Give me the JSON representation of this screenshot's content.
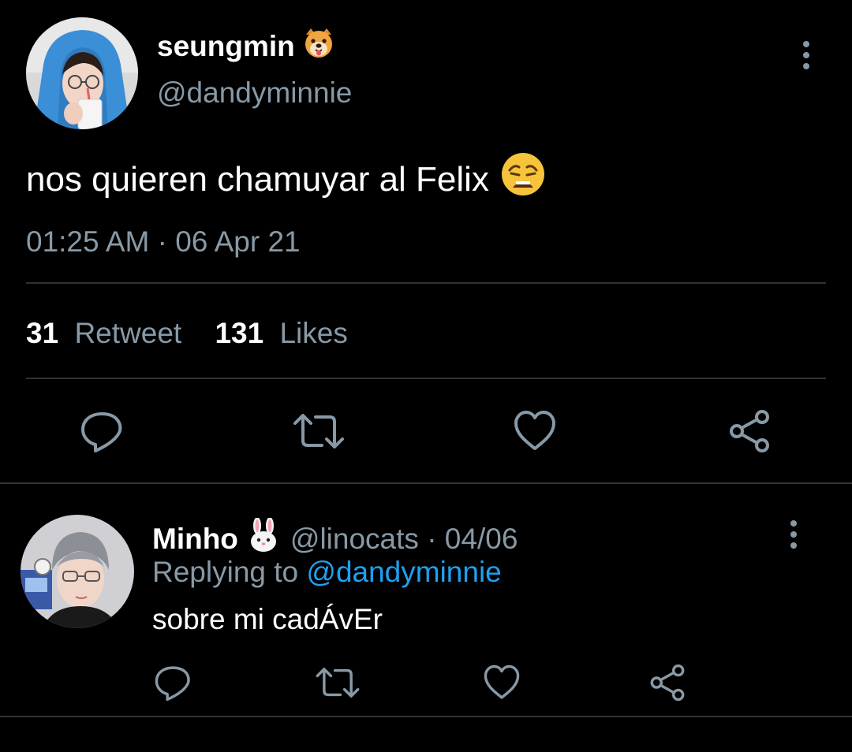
{
  "tweet": {
    "display_name": "seungmin",
    "name_emoji": "dog-face-emoji",
    "handle": "@dandyminnie",
    "text": "nos quieren chamuyar al Felix",
    "text_emoji": "weary-face-emoji",
    "timestamp": "01:25 AM · 06 Apr 21",
    "retweet_count": "31",
    "retweet_label": "Retweet",
    "likes_count": "131",
    "likes_label": "Likes",
    "actions": [
      "reply-icon",
      "retweet-icon",
      "like-icon",
      "share-icon"
    ]
  },
  "reply": {
    "display_name": "Minho",
    "name_emoji": "rabbit-face-emoji",
    "handle_date": "@linocats · 04/06",
    "replying_prefix": "Replying to",
    "replying_to": "@dandyminnie",
    "text": "sobre mi cadÁvEr",
    "actions": [
      "reply-icon",
      "retweet-icon",
      "like-icon",
      "share-icon"
    ]
  },
  "colors": {
    "background": "#000000",
    "primary_text": "#ffffff",
    "secondary_text": "#8899a6",
    "link": "#1da1f2",
    "divider": "#2f3336",
    "avatar_hoodie": "#3b8fd6"
  }
}
